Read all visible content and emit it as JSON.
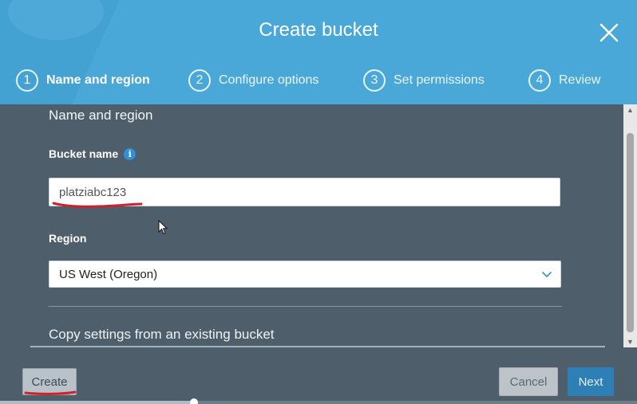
{
  "dialog": {
    "title": "Create bucket",
    "steps": [
      {
        "number": "1",
        "label": "Name and region",
        "active": true
      },
      {
        "number": "2",
        "label": "Configure options",
        "active": false
      },
      {
        "number": "3",
        "label": "Set permissions",
        "active": false
      },
      {
        "number": "4",
        "label": "Review",
        "active": false
      }
    ]
  },
  "form": {
    "section_title": "Name and region",
    "bucket_name_label": "Bucket name",
    "info_icon": "i",
    "bucket_name_value": "platziabc123",
    "region_label": "Region",
    "region_value": "US West (Oregon)",
    "copy_settings_label": "Copy settings from an existing bucket"
  },
  "footer": {
    "create_label": "Create",
    "cancel_label": "Cancel",
    "next_label": "Next"
  },
  "colors": {
    "header": "#4aa8d8",
    "body": "#4e5e6b",
    "primary_button": "#2e7fb5",
    "annotation_red": "#d0202a"
  },
  "icons": {
    "close": "close-icon",
    "chevron": "chevron-down-icon",
    "info": "info-icon",
    "cursor": "mouse-pointer-icon"
  }
}
